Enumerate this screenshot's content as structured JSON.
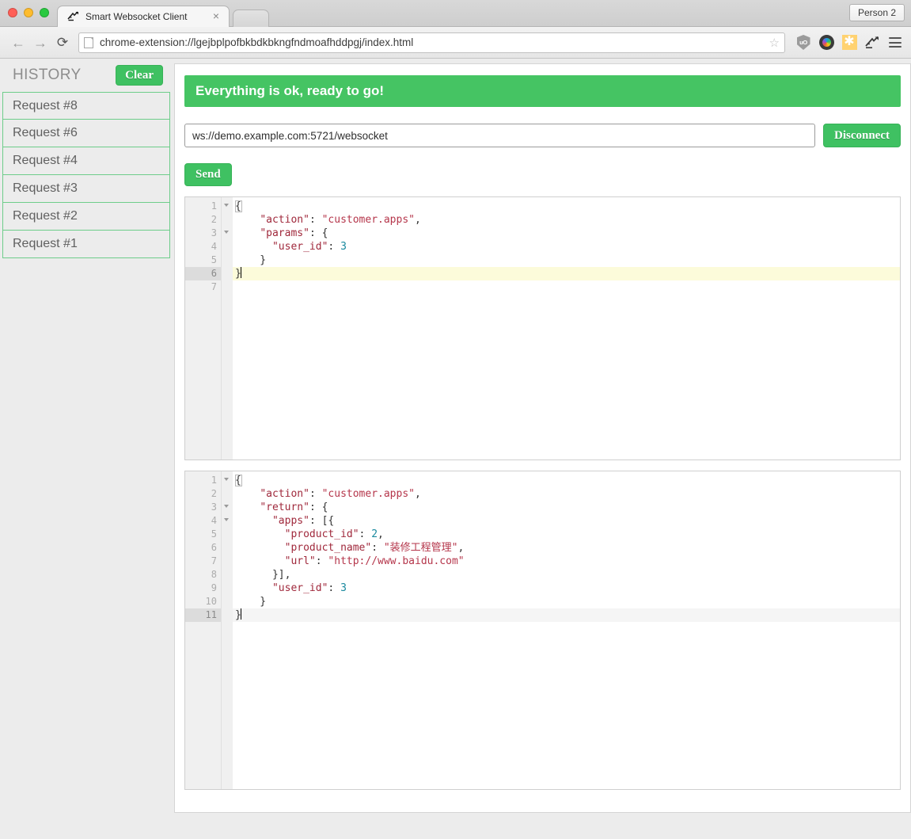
{
  "browser": {
    "window_controls": [
      "close",
      "minimize",
      "maximize"
    ],
    "tab": {
      "title": "Smart Websocket Client",
      "favicon": "websocket-icon",
      "close_label": "×"
    },
    "person_button": "Person 2",
    "nav": {
      "back": "←",
      "forward": "→",
      "reload": "⟳"
    },
    "omnibox": {
      "url": "chrome-extension://lgejbplpofbkbdkbkngfndmoafhddpgj/index.html",
      "page_icon": "page-icon",
      "bookmark_star": "☆"
    },
    "extensions": [
      {
        "name": "shield-icon",
        "label": "uO"
      },
      {
        "name": "camera-lens-icon",
        "label": ""
      },
      {
        "name": "asterisk-star-icon",
        "label": "✱"
      },
      {
        "name": "bird-icon",
        "label": ""
      },
      {
        "name": "hamburger-menu-icon",
        "label": ""
      }
    ]
  },
  "sidebar": {
    "title": "HISTORY",
    "clear_label": "Clear",
    "items": [
      {
        "label": "Request #8"
      },
      {
        "label": "Request #6"
      },
      {
        "label": "Request #4"
      },
      {
        "label": "Request #3"
      },
      {
        "label": "Request #2"
      },
      {
        "label": "Request #1"
      }
    ]
  },
  "main": {
    "status_banner": "Everything is ok, ready to go!",
    "url_value": "ws://demo.example.com:5721/websocket",
    "url_placeholder": "ws://",
    "disconnect_label": "Disconnect",
    "send_label": "Send"
  },
  "colors": {
    "accent_green": "#45c463",
    "banner_green": "#45c463",
    "button_green": "#3fc162",
    "history_border": "#6ecd8a",
    "key_red": "#a0293c",
    "string_red": "#b5364b",
    "number_teal": "#19899e",
    "active_line_yellow": "#fcfbda",
    "active_line_gray": "#f5f5f5",
    "gutter_bg": "#f0f0f0"
  },
  "request_editor": {
    "active_line": 6,
    "total_lines": 7,
    "lines": [
      {
        "num": 1,
        "fold": true,
        "tokens": [
          {
            "t": "{",
            "c": "p"
          }
        ]
      },
      {
        "num": 2,
        "fold": false,
        "tokens": [
          {
            "t": "    ",
            "c": "p"
          },
          {
            "t": "\"action\"",
            "c": "k"
          },
          {
            "t": ": ",
            "c": "p"
          },
          {
            "t": "\"customer.apps\"",
            "c": "s"
          },
          {
            "t": ",",
            "c": "p"
          }
        ]
      },
      {
        "num": 3,
        "fold": true,
        "tokens": [
          {
            "t": "    ",
            "c": "p"
          },
          {
            "t": "\"params\"",
            "c": "k"
          },
          {
            "t": ": {",
            "c": "p"
          }
        ]
      },
      {
        "num": 4,
        "fold": false,
        "tokens": [
          {
            "t": "      ",
            "c": "p"
          },
          {
            "t": "\"user_id\"",
            "c": "k"
          },
          {
            "t": ": ",
            "c": "p"
          },
          {
            "t": "3",
            "c": "n"
          }
        ]
      },
      {
        "num": 5,
        "fold": false,
        "tokens": [
          {
            "t": "    }",
            "c": "p"
          }
        ]
      },
      {
        "num": 6,
        "fold": false,
        "tokens": [
          {
            "t": "}",
            "c": "p"
          }
        ]
      },
      {
        "num": 7,
        "fold": false,
        "tokens": []
      }
    ]
  },
  "response_editor": {
    "active_line": 11,
    "total_lines": 11,
    "lines": [
      {
        "num": 1,
        "fold": true,
        "tokens": [
          {
            "t": "{",
            "c": "p"
          }
        ]
      },
      {
        "num": 2,
        "fold": false,
        "tokens": [
          {
            "t": "    ",
            "c": "p"
          },
          {
            "t": "\"action\"",
            "c": "k"
          },
          {
            "t": ": ",
            "c": "p"
          },
          {
            "t": "\"customer.apps\"",
            "c": "s"
          },
          {
            "t": ",",
            "c": "p"
          }
        ]
      },
      {
        "num": 3,
        "fold": true,
        "tokens": [
          {
            "t": "    ",
            "c": "p"
          },
          {
            "t": "\"return\"",
            "c": "k"
          },
          {
            "t": ": {",
            "c": "p"
          }
        ]
      },
      {
        "num": 4,
        "fold": true,
        "tokens": [
          {
            "t": "      ",
            "c": "p"
          },
          {
            "t": "\"apps\"",
            "c": "k"
          },
          {
            "t": ": [{",
            "c": "p"
          }
        ]
      },
      {
        "num": 5,
        "fold": false,
        "tokens": [
          {
            "t": "        ",
            "c": "p"
          },
          {
            "t": "\"product_id\"",
            "c": "k"
          },
          {
            "t": ": ",
            "c": "p"
          },
          {
            "t": "2",
            "c": "n"
          },
          {
            "t": ",",
            "c": "p"
          }
        ]
      },
      {
        "num": 6,
        "fold": false,
        "tokens": [
          {
            "t": "        ",
            "c": "p"
          },
          {
            "t": "\"product_name\"",
            "c": "k"
          },
          {
            "t": ": ",
            "c": "p"
          },
          {
            "t": "\"装修工程管理\"",
            "c": "s"
          },
          {
            "t": ",",
            "c": "p"
          }
        ]
      },
      {
        "num": 7,
        "fold": false,
        "tokens": [
          {
            "t": "        ",
            "c": "p"
          },
          {
            "t": "\"url\"",
            "c": "k"
          },
          {
            "t": ": ",
            "c": "p"
          },
          {
            "t": "\"http://www.baidu.com\"",
            "c": "s"
          }
        ]
      },
      {
        "num": 8,
        "fold": false,
        "tokens": [
          {
            "t": "      }],",
            "c": "p"
          }
        ]
      },
      {
        "num": 9,
        "fold": false,
        "tokens": [
          {
            "t": "      ",
            "c": "p"
          },
          {
            "t": "\"user_id\"",
            "c": "k"
          },
          {
            "t": ": ",
            "c": "p"
          },
          {
            "t": "3",
            "c": "n"
          }
        ]
      },
      {
        "num": 10,
        "fold": false,
        "tokens": [
          {
            "t": "    }",
            "c": "p"
          }
        ]
      },
      {
        "num": 11,
        "fold": false,
        "tokens": [
          {
            "t": "}",
            "c": "p"
          }
        ]
      }
    ]
  }
}
